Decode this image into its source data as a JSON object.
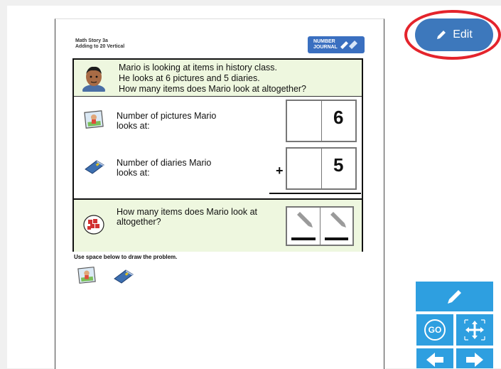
{
  "header": {
    "title_line1": "Math Story 3a",
    "title_line2": "Adding to 20 Vertical",
    "badge_line1": "NUMBER",
    "badge_line2": "JOURNAL"
  },
  "question": {
    "line1": "Mario is looking at items in history class.",
    "line2": "He looks at 6 pictures and 5 diaries.",
    "line3": "How many items does Mario look at altogether?"
  },
  "rows": [
    {
      "label_line1": "Number of pictures Mario",
      "label_line2": "looks at:",
      "operator": "",
      "digit": "6"
    },
    {
      "label_line1": "Number of diaries Mario",
      "label_line2": "looks at:",
      "operator": "+",
      "digit": "5"
    }
  ],
  "answer": {
    "label_line1": "How many items does Mario look at",
    "label_line2": "altogether?"
  },
  "draw_caption": "Use space below to draw the problem.",
  "edit_button": {
    "label": "Edit",
    "icon": "pencil-icon"
  },
  "toolbar": {
    "go_label": "GO",
    "icons": [
      "pencil-icon",
      "move-icon",
      "arrow-left-icon",
      "arrow-right-icon"
    ]
  },
  "colors": {
    "accent_blue": "#3d78bc",
    "toolbar_blue": "#2e9fe0",
    "highlight_ring": "#e4242c",
    "story_panel": "#eef7df"
  }
}
